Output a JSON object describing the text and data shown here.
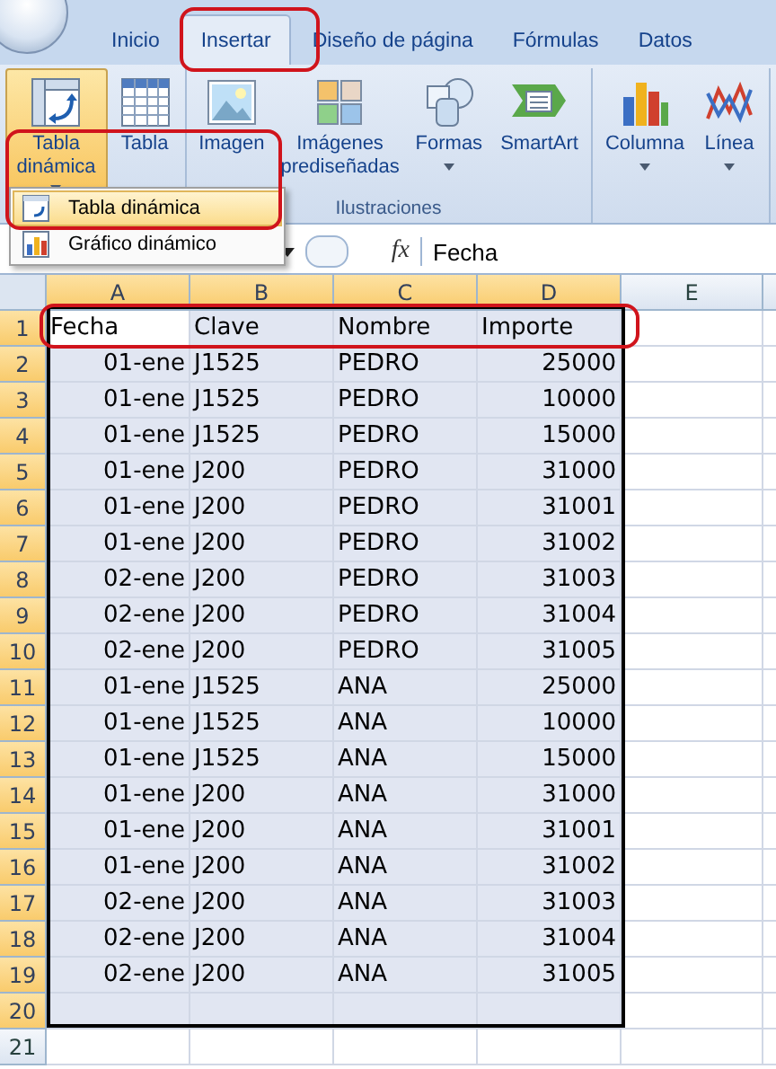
{
  "tabs": [
    {
      "label": "Inicio",
      "selected": false
    },
    {
      "label": "Insertar",
      "selected": true
    },
    {
      "label": "Diseño de página",
      "selected": false
    },
    {
      "label": "Fórmulas",
      "selected": false
    },
    {
      "label": "Datos",
      "selected": false
    }
  ],
  "ribbon": {
    "groups": [
      {
        "buttons": [
          {
            "kind": "pivot",
            "label": "Tabla dinámica",
            "dropdown": true,
            "pressed": true
          },
          {
            "kind": "table",
            "label": "Tabla",
            "dropdown": false,
            "pressed": false
          }
        ]
      },
      {
        "label": "Ilustraciones",
        "buttons": [
          {
            "kind": "picture",
            "label": "Imagen",
            "dropdown": false,
            "pressed": false
          },
          {
            "kind": "clipart",
            "label": "Imágenes prediseñadas",
            "dropdown": false,
            "pressed": false
          },
          {
            "kind": "shapes",
            "label": "Formas",
            "dropdown": true,
            "pressed": false
          },
          {
            "kind": "smartart",
            "label": "SmartArt",
            "dropdown": false,
            "pressed": false
          }
        ]
      },
      {
        "buttons": [
          {
            "kind": "column",
            "label": "Columna",
            "dropdown": true,
            "pressed": false
          },
          {
            "kind": "line",
            "label": "Línea",
            "dropdown": true,
            "pressed": false
          }
        ]
      }
    ]
  },
  "menu": [
    {
      "kind": "pivot",
      "label": "Tabla dinámica",
      "selected": true
    },
    {
      "kind": "pivotchart",
      "label": "Gráfico dinámico",
      "selected": false
    }
  ],
  "formula_bar": {
    "fx": "fx",
    "value": "Fecha"
  },
  "sheet": {
    "columns": [
      {
        "label": "A",
        "selected": true
      },
      {
        "label": "B",
        "selected": true
      },
      {
        "label": "C",
        "selected": true
      },
      {
        "label": "D",
        "selected": true
      },
      {
        "label": "E",
        "selected": false
      }
    ],
    "rows": [
      {
        "number": "1",
        "kind": "header",
        "selected": true,
        "cells": [
          "Fecha",
          "Clave",
          "Nombre",
          "Importe"
        ]
      },
      {
        "number": "2",
        "kind": "data",
        "selected": true,
        "cells": [
          "01-ene",
          "J1525",
          "PEDRO",
          "25000"
        ]
      },
      {
        "number": "3",
        "kind": "data",
        "selected": true,
        "cells": [
          "01-ene",
          "J1525",
          "PEDRO",
          "10000"
        ]
      },
      {
        "number": "4",
        "kind": "data",
        "selected": true,
        "cells": [
          "01-ene",
          "J1525",
          "PEDRO",
          "15000"
        ]
      },
      {
        "number": "5",
        "kind": "data",
        "selected": true,
        "cells": [
          "01-ene",
          "J200",
          "PEDRO",
          "31000"
        ]
      },
      {
        "number": "6",
        "kind": "data",
        "selected": true,
        "cells": [
          "01-ene",
          "J200",
          "PEDRO",
          "31001"
        ]
      },
      {
        "number": "7",
        "kind": "data",
        "selected": true,
        "cells": [
          "01-ene",
          "J200",
          "PEDRO",
          "31002"
        ]
      },
      {
        "number": "8",
        "kind": "data",
        "selected": true,
        "cells": [
          "02-ene",
          "J200",
          "PEDRO",
          "31003"
        ]
      },
      {
        "number": "9",
        "kind": "data",
        "selected": true,
        "cells": [
          "02-ene",
          "J200",
          "PEDRO",
          "31004"
        ]
      },
      {
        "number": "10",
        "kind": "data",
        "selected": true,
        "cells": [
          "02-ene",
          "J200",
          "PEDRO",
          "31005"
        ]
      },
      {
        "number": "11",
        "kind": "data",
        "selected": true,
        "cells": [
          "01-ene",
          "J1525",
          "ANA",
          "25000"
        ]
      },
      {
        "number": "12",
        "kind": "data",
        "selected": true,
        "cells": [
          "01-ene",
          "J1525",
          "ANA",
          "10000"
        ]
      },
      {
        "number": "13",
        "kind": "data",
        "selected": true,
        "cells": [
          "01-ene",
          "J1525",
          "ANA",
          "15000"
        ]
      },
      {
        "number": "14",
        "kind": "data",
        "selected": true,
        "cells": [
          "01-ene",
          "J200",
          "ANA",
          "31000"
        ]
      },
      {
        "number": "15",
        "kind": "data",
        "selected": true,
        "cells": [
          "01-ene",
          "J200",
          "ANA",
          "31001"
        ]
      },
      {
        "number": "16",
        "kind": "data",
        "selected": true,
        "cells": [
          "01-ene",
          "J200",
          "ANA",
          "31002"
        ]
      },
      {
        "number": "17",
        "kind": "data",
        "selected": true,
        "cells": [
          "02-ene",
          "J200",
          "ANA",
          "31003"
        ]
      },
      {
        "number": "18",
        "kind": "data",
        "selected": true,
        "cells": [
          "02-ene",
          "J200",
          "ANA",
          "31004"
        ]
      },
      {
        "number": "19",
        "kind": "data",
        "selected": true,
        "cells": [
          "02-ene",
          "J200",
          "ANA",
          "31005"
        ]
      },
      {
        "number": "20",
        "kind": "data",
        "selected": true,
        "cells": []
      },
      {
        "number": "21",
        "kind": "data",
        "selected": false,
        "cells": []
      }
    ]
  }
}
